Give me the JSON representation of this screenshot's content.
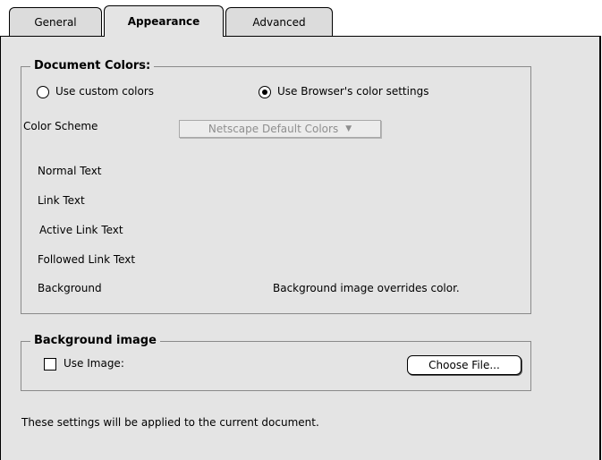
{
  "tabs": [
    {
      "label": "General"
    },
    {
      "label": "Appearance"
    },
    {
      "label": "Advanced"
    }
  ],
  "document_colors": {
    "title": "Document Colors:",
    "radio_custom": "Use custom colors",
    "radio_browser": "Use Browser's color settings",
    "scheme_label": "Color Scheme",
    "scheme_value": "Netscape Default Colors",
    "rows": [
      "Normal Text",
      "Link Text",
      "Active Link Text",
      "Followed Link Text",
      "Background"
    ],
    "background_note": "Background image overrides color."
  },
  "background_image": {
    "title": "Background image",
    "use_image_label": "Use Image:",
    "choose_button": "Choose File..."
  },
  "footer_note": "These settings will be applied to the current document."
}
